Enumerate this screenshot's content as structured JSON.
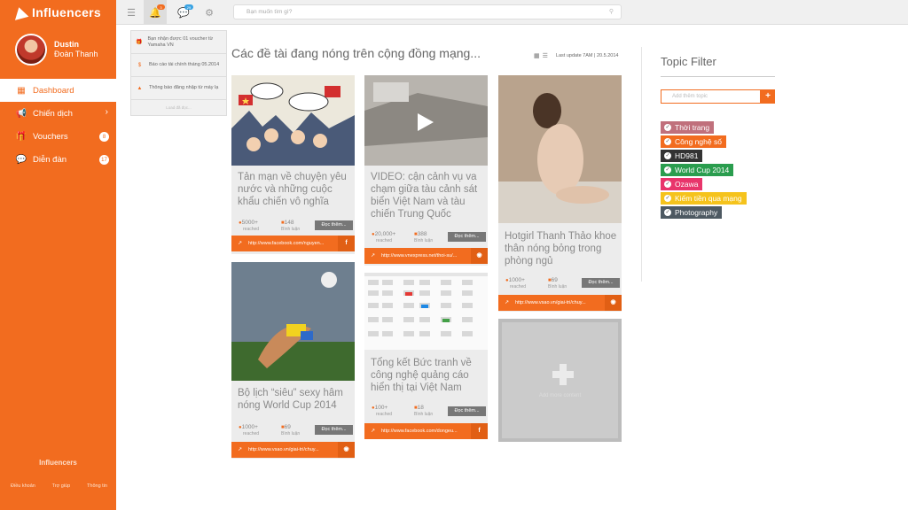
{
  "sidebar": {
    "brand": "Influencers",
    "user": {
      "first": "Dustin",
      "last": "Đoàn Thanh"
    },
    "nav": [
      {
        "label": "Dashboard",
        "icon": "dashboard-icon",
        "active": true
      },
      {
        "label": "Chiến dịch",
        "icon": "megaphone-icon"
      },
      {
        "label": "Vouchers",
        "icon": "gift-icon",
        "badge": "8"
      },
      {
        "label": "Diễn đàn",
        "icon": "chat-icon",
        "badge": "17"
      }
    ],
    "footer_brand": "Influencers",
    "footer_links": [
      "Điều khoản",
      "Trợ giúp",
      "Thông tin"
    ]
  },
  "topbar": {
    "notif_count": "3",
    "msg_count": "29",
    "search_placeholder": "Bạn muốn tìm gì?"
  },
  "notifications": {
    "items": [
      {
        "icon": "gift-icon",
        "text": "Bạn nhận được 01 voucher từ Yamaha VN"
      },
      {
        "icon": "dollar-icon",
        "text": "Báo cáo tài chính tháng 05.2014"
      },
      {
        "icon": "warning-icon",
        "text": "Thông báo đăng nhập từ máy lạ"
      }
    ],
    "more": "Load đã đọc..."
  },
  "main": {
    "title": "Các đề tài đang nóng trên cộng đồng mạng...",
    "last_update": "Last update 7AM | 20.5.2014"
  },
  "cards": [
    {
      "title": "Tản mạn về chuyện yêu nước và những cuộc khẩu chiến vô nghĩa",
      "reached": "5000+",
      "reached_label": "reached",
      "comments": "148",
      "comments_label": "Bình luận",
      "read": "Đọc thêm...",
      "url": "http://www.facebook.com/nguyen...",
      "social": "f"
    },
    {
      "title": "Bộ lịch “siêu” sexy hâm nóng World Cup 2014",
      "reached": "1000+",
      "reached_label": "reached",
      "comments": "69",
      "comments_label": "Bình luận",
      "read": "Đọc thêm...",
      "url": "http://www.vsao.vn/giai-tri/chuy...",
      "social": "◉"
    },
    {
      "title": "VIDEO: cận cảnh vụ va chạm giữa tàu cảnh sát biển Việt Nam và tàu chiến Trung Quốc",
      "reached": "20,000+",
      "reached_label": "reached",
      "comments": "388",
      "comments_label": "Bình luận",
      "read": "Đọc thêm...",
      "url": "http://www.vnexpress.net/thoi-su/...",
      "social": "◉"
    },
    {
      "title": "Tổng kết Bức tranh về công nghệ quảng cáo hiển thị tại Việt Nam",
      "reached": "100+",
      "reached_label": "reached",
      "comments": "18",
      "comments_label": "Bình luận",
      "read": "Đọc thêm...",
      "url": "http://www.facebook.com/dongeu...",
      "social": "f"
    },
    {
      "title": "Hotgirl Thanh Thảo khoe thân nóng bỏng trong phòng ngủ",
      "reached": "1000+",
      "reached_label": "reached",
      "comments": "69",
      "comments_label": "Bình luận",
      "read": "Đọc thêm...",
      "url": "http://www.vsao.vn/giai-tri/chuy...",
      "social": "◉"
    }
  ],
  "add_card": {
    "label": "Add more content"
  },
  "topic_filter": {
    "title": "Topic Filter",
    "placeholder": "Add thêm topic",
    "tags": [
      {
        "label": "Thời trang",
        "color": "#c0707c"
      },
      {
        "label": "Công nghệ số",
        "color": "#f26c1f"
      },
      {
        "label": "HD981",
        "color": "#333333"
      },
      {
        "label": "World Cup 2014",
        "color": "#2a9d4e"
      },
      {
        "label": "Ozawa",
        "color": "#e8356b"
      },
      {
        "label": "Kiếm tiền qua mạng",
        "color": "#f5c31c"
      },
      {
        "label": "Photography",
        "color": "#4d5962"
      }
    ]
  }
}
